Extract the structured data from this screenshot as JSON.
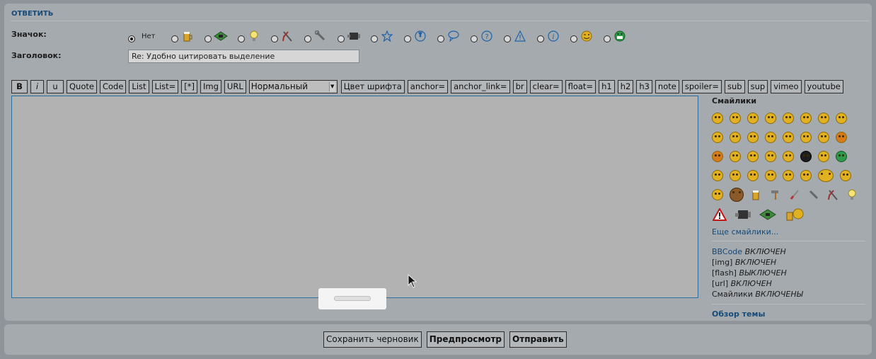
{
  "reply_form": {
    "heading": "ОТВЕТИТЬ",
    "icon_label": "Значок:",
    "icon_none": "Нет",
    "topic_icons": [
      "beer-icon",
      "chip-board-icon",
      "light-bulb-icon",
      "pliers-icon",
      "wrench-icon",
      "engine-icon",
      "star-icon",
      "radioactive-icon",
      "speech-bubble-icon",
      "question-icon",
      "warning-icon",
      "info-icon",
      "wink-smiley-icon",
      "grin-smiley-icon"
    ],
    "subject_label": "Заголовок:",
    "subject_value": "Re: Удобно цитировать выделение"
  },
  "toolbar": {
    "bold": "B",
    "italic": "i",
    "underline": "u",
    "buttons_left": [
      "Quote",
      "Code",
      "List",
      "List=",
      "[*]",
      "Img",
      "URL"
    ],
    "font_size_selected": "Нормальный",
    "buttons_right": [
      "Цвет шрифта",
      "anchor=",
      "anchor_link=",
      "br",
      "clear=",
      "float=",
      "h1",
      "h2",
      "h3",
      "note",
      "spoiler=",
      "sub",
      "sup",
      "vimeo",
      "youtube"
    ]
  },
  "sidebar": {
    "smileys_title": "Смайлики",
    "more_smileys": "Еще смайлики...",
    "status": [
      {
        "key": "BBCode",
        "value": "ВКЛЮЧЕН"
      },
      {
        "key": "[img]",
        "value": "ВКЛЮЧЕН"
      },
      {
        "key": "[flash]",
        "value": "ВЫКЛЮЧЕН"
      },
      {
        "key": "[url]",
        "value": "ВКЛЮЧЕН"
      },
      {
        "key": "Смайлики",
        "value": "ВКЛЮЧЕНЫ"
      }
    ],
    "topic_overview": "Обзор темы"
  },
  "actions": {
    "save_draft": "Сохранить черновик",
    "preview": "Предпросмотр",
    "submit": "Отправить"
  },
  "colors": {
    "link": "#164a78",
    "panel": "#a5aaae",
    "editor_border": "#2e6fa0"
  }
}
